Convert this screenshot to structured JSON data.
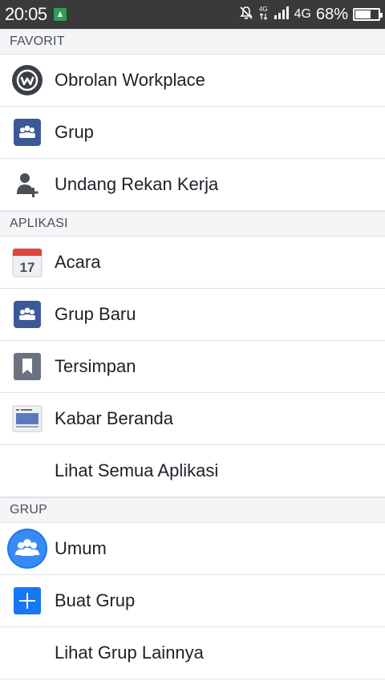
{
  "status_bar": {
    "time": "20:05",
    "network": "4G",
    "battery_percent": "68%",
    "battery_level": 0.68
  },
  "sections": [
    {
      "header": "FAVORIT",
      "items": [
        {
          "label": "Obrolan Workplace",
          "icon": "workplace-chat-icon"
        },
        {
          "label": "Grup",
          "icon": "group-icon"
        },
        {
          "label": "Undang Rekan Kerja",
          "icon": "add-person-icon"
        }
      ]
    },
    {
      "header": "APLIKASI",
      "items": [
        {
          "label": "Acara",
          "icon": "calendar-icon",
          "calendar_day": "17"
        },
        {
          "label": "Grup Baru",
          "icon": "group-icon"
        },
        {
          "label": "Tersimpan",
          "icon": "bookmark-icon"
        },
        {
          "label": "Kabar Beranda",
          "icon": "news-feed-icon"
        },
        {
          "label": "Lihat Semua Aplikasi",
          "icon": ""
        }
      ]
    },
    {
      "header": "GRUP",
      "items": [
        {
          "label": "Umum",
          "icon": "group-avatar-icon"
        },
        {
          "label": "Buat Grup",
          "icon": "plus-icon"
        },
        {
          "label": "Lihat Grup Lainnya",
          "icon": ""
        }
      ]
    }
  ],
  "colors": {
    "facebook_blue": "#3b5998",
    "accent_blue": "#1877f2",
    "header_bg": "#f4f5f7",
    "divider": "#e1e3e8"
  }
}
